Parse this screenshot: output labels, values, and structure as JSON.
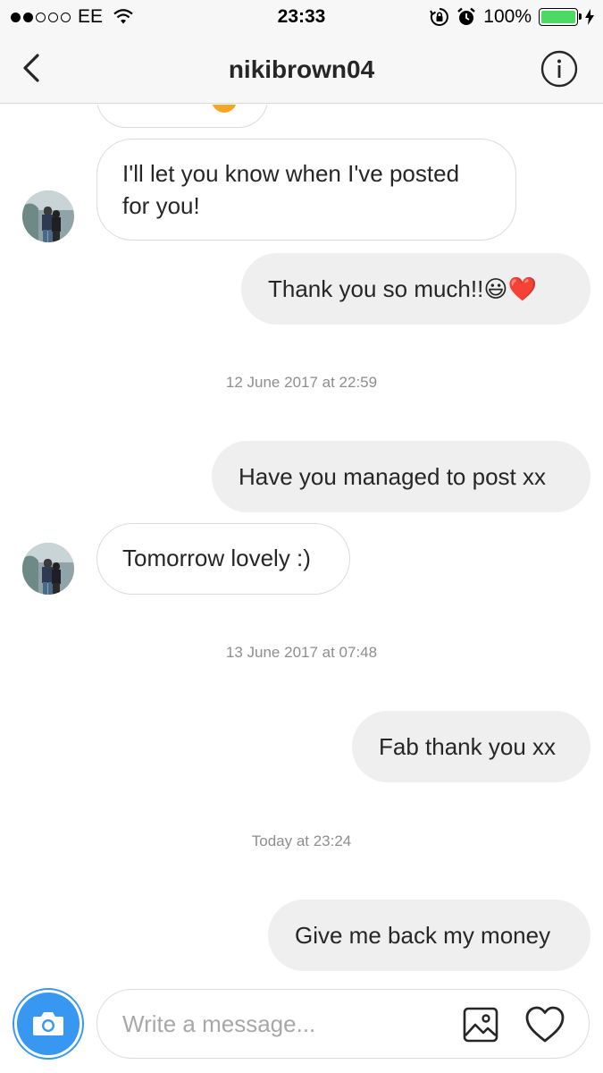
{
  "status_bar": {
    "carrier": "EE",
    "time": "23:33",
    "battery_percent": "100%",
    "signal_bars_filled": 2,
    "signal_bars_total": 5,
    "battery_color": "#4cd964"
  },
  "header": {
    "title": "nikibrown04",
    "back_icon": "chevron-left-icon",
    "info_icon": "info-circle-icon"
  },
  "messages": [
    {
      "direction": "in",
      "text": "I'll let you know when I've posted\nfor you!"
    },
    {
      "direction": "out",
      "text": "Thank you so much!!😃❤️"
    },
    {
      "type": "timestamp",
      "text": "12 June 2017 at 22:59"
    },
    {
      "direction": "out",
      "text": "Have you managed to post xx"
    },
    {
      "direction": "in",
      "text": "Tomorrow lovely :)"
    },
    {
      "type": "timestamp",
      "text": "13 June 2017 at 07:48"
    },
    {
      "direction": "out",
      "text": "Fab thank you xx"
    },
    {
      "type": "timestamp",
      "text": "Today at 23:24"
    },
    {
      "direction": "out",
      "text": "Give me back my money"
    }
  ],
  "composer": {
    "placeholder": "Write a message...",
    "accent_color": "#3897f0",
    "camera_icon": "camera-icon",
    "gallery_icon": "image-icon",
    "heart_icon": "heart-icon"
  }
}
